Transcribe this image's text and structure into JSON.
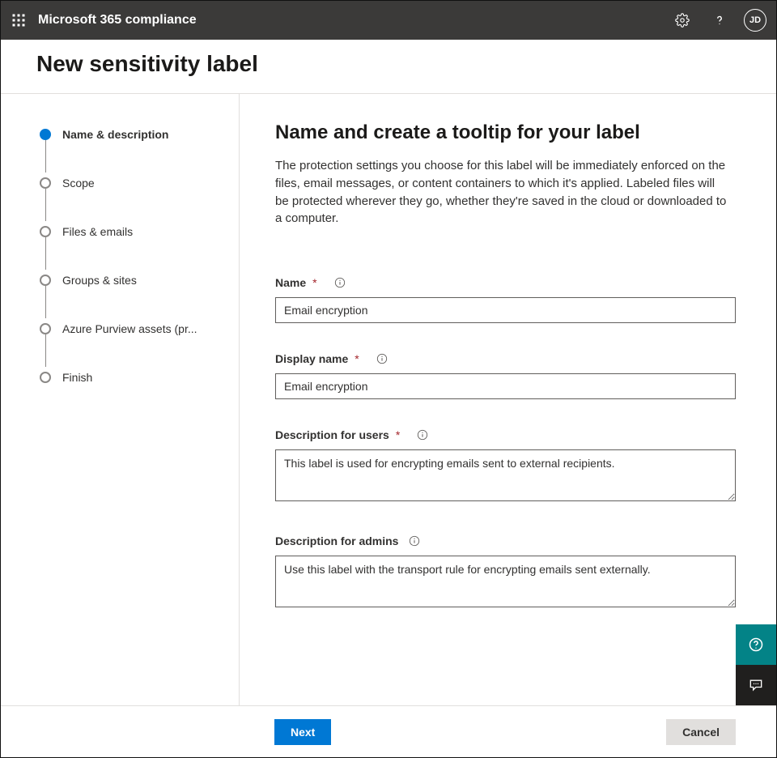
{
  "header": {
    "product_name": "Microsoft 365 compliance",
    "user_initials": "JD"
  },
  "page": {
    "title": "New sensitivity label"
  },
  "wizard": {
    "steps": [
      {
        "label": "Name & description",
        "active": true
      },
      {
        "label": "Scope",
        "active": false
      },
      {
        "label": "Files & emails",
        "active": false
      },
      {
        "label": "Groups & sites",
        "active": false
      },
      {
        "label": "Azure Purview assets (pr...",
        "active": false
      },
      {
        "label": "Finish",
        "active": false
      }
    ]
  },
  "form": {
    "heading": "Name and create a tooltip for your label",
    "intro": "The protection settings you choose for this label will be immediately enforced on the files, email messages, or content containers to which it's applied. Labeled files will be protected wherever they go, whether they're saved in the cloud or downloaded to a computer.",
    "fields": {
      "name": {
        "label": "Name",
        "required_mark": "*",
        "value": "Email encryption"
      },
      "display_name": {
        "label": "Display name",
        "required_mark": "*",
        "value": "Email encryption"
      },
      "description_users": {
        "label": "Description for users",
        "required_mark": "*",
        "value": "This label is used for encrypting emails sent to external recipients."
      },
      "description_admins": {
        "label": "Description for admins",
        "value": "Use this label with the transport rule for encrypting emails sent externally."
      }
    }
  },
  "footer": {
    "next_label": "Next",
    "cancel_label": "Cancel"
  }
}
